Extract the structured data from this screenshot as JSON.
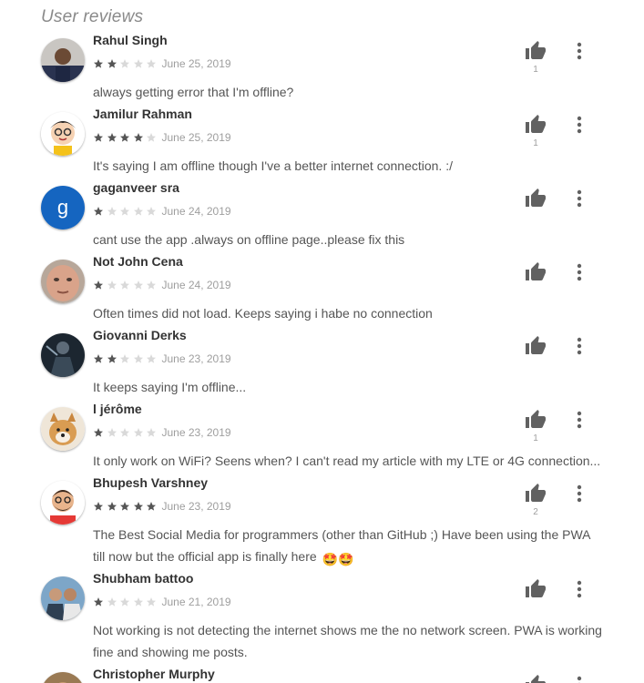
{
  "section_title": "User reviews",
  "colors": {
    "star_filled": "#555555",
    "star_empty": "#d9d9d9",
    "thumb": "#616161",
    "menu": "#616161"
  },
  "reviews": [
    {
      "name": "Rahul Singh",
      "rating": 2,
      "date": "June 25, 2019",
      "text": "always getting error that I'm offline?",
      "likes": "1",
      "avatar": "photo-man-dark"
    },
    {
      "name": "Jamilur Rahman",
      "rating": 4,
      "date": "June 25, 2019",
      "text": "It's saying I am offline though I've a better internet connection. :/",
      "likes": "1",
      "avatar": "cartoon-character"
    },
    {
      "name": "gaganveer sra",
      "rating": 1,
      "date": "June 24, 2019",
      "text": "cant use the app .always on offline page..please fix this",
      "likes": "",
      "avatar": "letter-avatar",
      "avatar_letter": "g"
    },
    {
      "name": "Not John Cena",
      "rating": 1,
      "date": "June 24, 2019",
      "text": "Often times did not load. Keeps saying i habe no connection",
      "likes": "",
      "avatar": "photo-face-closeup"
    },
    {
      "name": "Giovanni Derks",
      "rating": 2,
      "date": "June 23, 2019",
      "text": "It keeps saying I'm offline...",
      "likes": "",
      "avatar": "photo-dark-figure"
    },
    {
      "name": "l jérôme",
      "rating": 1,
      "date": "June 23, 2019",
      "text": "It only work on WiFi? Seens when? I can't read my article with my LTE or 4G connection...",
      "likes": "1",
      "avatar": "photo-dog"
    },
    {
      "name": "Bhupesh Varshney",
      "rating": 5,
      "date": "June 23, 2019",
      "text": "The Best Social Media for programmers (other than GitHub ;) Have been using the PWA till now but the official app is finally here",
      "emoji": "🤩🤩",
      "likes": "2",
      "avatar": "cartoon-bearded-man"
    },
    {
      "name": "Shubham battoo",
      "rating": 1,
      "date": "June 21, 2019",
      "text": "Not working is not detecting the internet shows me the no network screen. PWA is working fine and showing me posts.",
      "likes": "",
      "avatar": "photo-two-men"
    },
    {
      "name": "Christopher Murphy",
      "rating": 0,
      "date": "",
      "text": "",
      "likes": "",
      "avatar": "photo-partial"
    }
  ]
}
